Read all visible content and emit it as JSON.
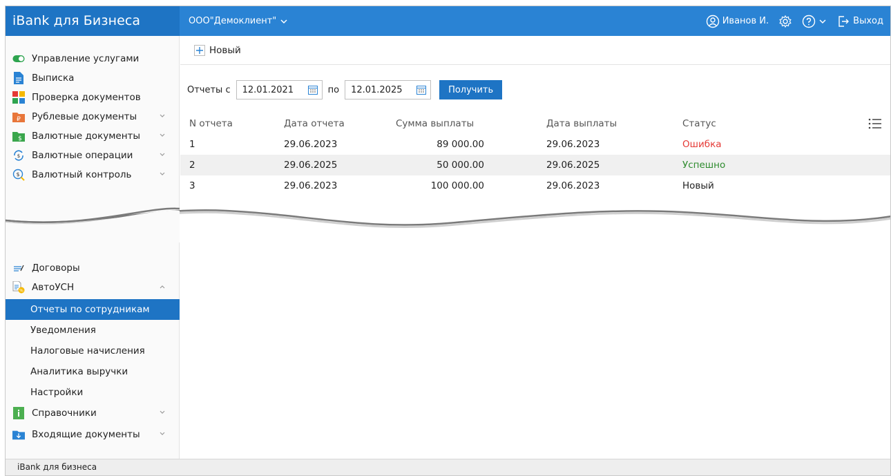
{
  "header": {
    "brand": "iBank для Бизнеса",
    "org": "ООО\"Демоклиент\"",
    "user": "Иванов И.",
    "logout": "Выход"
  },
  "sidebar": {
    "items": [
      {
        "label": "Управление услугами",
        "icon": "toggle-icon"
      },
      {
        "label": "Выписка",
        "icon": "document-icon"
      },
      {
        "label": "Проверка документов",
        "icon": "check-grid-icon"
      },
      {
        "label": "Рублевые документы",
        "icon": "ruble-folder-icon"
      },
      {
        "label": "Валютные документы",
        "icon": "dollar-folder-icon"
      },
      {
        "label": "Валютные операции",
        "icon": "exchange-icon"
      },
      {
        "label": "Валютный контроль",
        "icon": "currency-search-icon"
      },
      {
        "label": "Договоры",
        "icon": "contract-icon"
      },
      {
        "label": "АвтоУСН",
        "icon": "autousn-icon"
      },
      {
        "label": "Отчеты по сотрудникам"
      },
      {
        "label": "Уведомления"
      },
      {
        "label": "Налоговые начисления"
      },
      {
        "label": "Аналитика выручки"
      },
      {
        "label": "Настройки"
      },
      {
        "label": "Справочники",
        "icon": "reference-book-icon"
      },
      {
        "label": "Входящие документы",
        "icon": "inbox-icon"
      }
    ]
  },
  "toolbar": {
    "new_label": "Новый"
  },
  "filter": {
    "from_label": "Отчеты с",
    "from_value": "12.01.2021",
    "to_label": "по",
    "to_value": "12.01.2025",
    "get_label": "Получить"
  },
  "table": {
    "headers": [
      "N отчета",
      "Дата отчета",
      "Сумма выплаты",
      "Дата выплаты",
      "Статус"
    ],
    "rows": [
      [
        "1",
        "29.06.2023",
        "89 000.00",
        "29.06.2023",
        "Ошибка"
      ],
      [
        "2",
        "29.06.2025",
        "50 000.00",
        "29.06.2025",
        "Успешно"
      ],
      [
        "3",
        "29.06.2023",
        "100 000.00",
        "29.06.2023",
        "Новый"
      ]
    ]
  },
  "colors": {
    "brand": "#1e74c4",
    "header": "#2a83d4",
    "error": "#e53935",
    "success": "#2e8b2e"
  },
  "footer": {
    "text": "iBank для бизнеса"
  }
}
